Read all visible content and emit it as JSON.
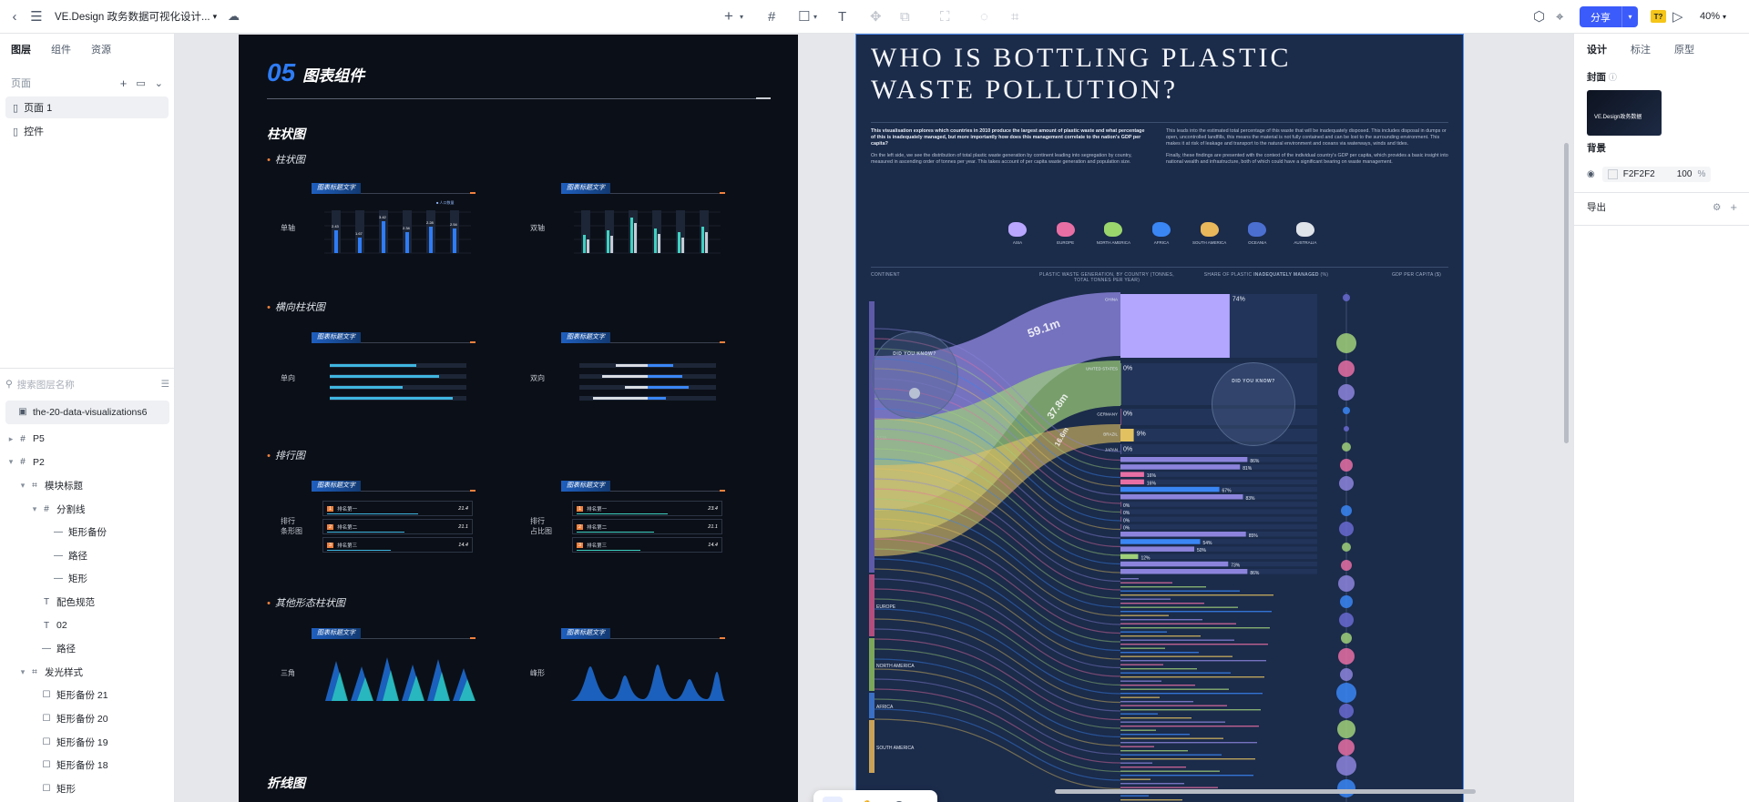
{
  "topbar": {
    "back_icon": "back-icon",
    "menu_icon": "menu-icon",
    "file_title": "VE.Design 政务数据可视化设计...",
    "share_label": "分享",
    "ai_badge": "T?",
    "zoom": "40%"
  },
  "left_panel": {
    "tabs": [
      "图层",
      "组件",
      "资源"
    ],
    "pages_label": "页面",
    "pages": [
      "页面 1",
      "控件"
    ],
    "search_placeholder": "搜索图层名称",
    "layers": [
      {
        "name": "the-20-data-visualizations6",
        "type": "image",
        "depth": 0,
        "caret": ""
      },
      {
        "name": "P5",
        "type": "frame",
        "depth": 0,
        "caret": "▸"
      },
      {
        "name": "P2",
        "type": "frame",
        "depth": 0,
        "caret": "▾"
      },
      {
        "name": "模块标题",
        "type": "group",
        "depth": 1,
        "caret": "▾"
      },
      {
        "name": "分割线",
        "type": "frame",
        "depth": 2,
        "caret": "▾"
      },
      {
        "name": "矩形备份",
        "type": "line",
        "depth": 3,
        "caret": ""
      },
      {
        "name": "路径",
        "type": "line",
        "depth": 3,
        "caret": ""
      },
      {
        "name": "矩形",
        "type": "line",
        "depth": 3,
        "caret": ""
      },
      {
        "name": "配色规范",
        "type": "text",
        "depth": 2,
        "caret": ""
      },
      {
        "name": "02",
        "type": "text",
        "depth": 2,
        "caret": ""
      },
      {
        "name": "路径",
        "type": "line",
        "depth": 2,
        "caret": ""
      },
      {
        "name": "发光样式",
        "type": "group",
        "depth": 1,
        "caret": "▾"
      },
      {
        "name": "矩形备份 21",
        "type": "rect",
        "depth": 2,
        "caret": ""
      },
      {
        "name": "矩形备份 20",
        "type": "rect",
        "depth": 2,
        "caret": ""
      },
      {
        "name": "矩形备份 19",
        "type": "rect",
        "depth": 2,
        "caret": ""
      },
      {
        "name": "矩形备份 18",
        "type": "rect",
        "depth": 2,
        "caret": ""
      },
      {
        "name": "矩形",
        "type": "rect",
        "depth": 2,
        "caret": ""
      }
    ]
  },
  "right_panel": {
    "tabs": [
      "设计",
      "标注",
      "原型"
    ],
    "cover_label": "封面",
    "cover_thumb_text": "VE.Design政务数据",
    "bg_label": "背景",
    "bg_hex": "F2F2F2",
    "bg_opacity": "100",
    "opacity_unit": "%",
    "export_label": "导出"
  },
  "artboard_dark": {
    "num": "05",
    "title": "图表组件",
    "sections": [
      {
        "title": "柱状图",
        "sub": "柱状图"
      },
      {
        "title": "",
        "sub": "横向柱状图"
      },
      {
        "title": "",
        "sub": "排行图"
      },
      {
        "title": "",
        "sub": "其他形态柱状图"
      },
      {
        "title": "折线图",
        "sub": ""
      }
    ],
    "rows": [
      {
        "left_label": "单轴",
        "right_label": "双轴"
      },
      {
        "left_label": "单向",
        "right_label": "双向"
      },
      {
        "left_label": "排行\n条形图",
        "right_label": "排行\n占比图"
      },
      {
        "left_label": "三角",
        "right_label": "峰形"
      }
    ],
    "card_title": "图表标题文字",
    "rank_items_left": [
      {
        "name": "排名第一",
        "value": "21.4"
      },
      {
        "name": "排名第二",
        "value": "21.1"
      },
      {
        "name": "排名第三",
        "value": "14.4"
      }
    ],
    "rank_items_right": [
      {
        "name": "排名第一",
        "value": "23.4"
      },
      {
        "name": "排名第二",
        "value": "21.1"
      },
      {
        "name": "排名第三",
        "value": "14.4"
      }
    ]
  },
  "infographic": {
    "title_line1": "WHO IS BOTTLING PLASTIC",
    "title_line2": "WASTE POLLUTION?",
    "intro_left": "This visualisation explores which countries in 2010 produce the largest amount of plastic waste and what percentage of this is inadequately managed, but more importantly how does this management correlate to the nation's GDP per capita?",
    "intro_left2": "On the left side, we see the distribution of total plastic waste generation by continent leading into segregation by country, measured in ascending order of tonnes per year. This takes account of per capita waste generation and population size.",
    "intro_right": "This leads into the estimated total percentage of this waste that will be inadequately disposed. This includes disposal in dumps or open, uncontrolled landfills, this means the material is not fully contained and can be lost to the surrounding environment. This makes it at risk of leakage and transport to the natural environment and oceans via waterways, winds and tides.",
    "intro_right2": "Finally, these findings are presented with the context of the individual country's GDP per capita, which provides a basic insight into national wealth and infrastructure, both of which could have a significant bearing on waste management.",
    "continents": [
      "ASIA",
      "EUROPE",
      "NORTH AMERICA",
      "AFRICA",
      "SOUTH AMERICA",
      "OCEANIA",
      "AUSTRALIA"
    ],
    "col_continent": "CONTINENT",
    "col_generation": "PLASTIC WASTE GENERATION, BY COUNTRY (TONNES, TOTAL TONNES PER YEAR)",
    "col_share_pre": "SHARE OF PLASTIC",
    "col_share_bold": "INADEQUATELY MANAGED",
    "col_share_post": "(%)",
    "col_gdp": "GDP PER CAPITA ($)",
    "pct_ticks": [
      "0%",
      "20%",
      "40%",
      "60%",
      "80%",
      "100%"
    ],
    "flow_labels": [
      "59.1m",
      "37.8m",
      "16.6m"
    ],
    "did_you_know": "DID YOU KNOW?",
    "side_labels": [
      "ASIA",
      "EUROPE",
      "NORTH AMERICA",
      "AFRICA",
      "SOUTH AMERICA"
    ],
    "countries": [
      {
        "name": "CHINA",
        "pct": "74%"
      },
      {
        "name": "UNITED STATES",
        "pct": "0%"
      },
      {
        "name": "GERMANY",
        "pct": "0%"
      },
      {
        "name": "BRAZIL",
        "pct": "9%"
      },
      {
        "name": "JAPAN",
        "pct": "0%"
      },
      {
        "name": "",
        "pct": "86%"
      },
      {
        "name": "",
        "pct": "81%"
      },
      {
        "name": "",
        "pct": "16%"
      },
      {
        "name": "",
        "pct": "16%"
      },
      {
        "name": "",
        "pct": "67%"
      },
      {
        "name": "",
        "pct": "83%"
      },
      {
        "name": "",
        "pct": "0%"
      },
      {
        "name": "",
        "pct": "0%"
      },
      {
        "name": "",
        "pct": "0%"
      },
      {
        "name": "",
        "pct": "0%"
      },
      {
        "name": "",
        "pct": "85%"
      },
      {
        "name": "",
        "pct": "54%"
      },
      {
        "name": "",
        "pct": "50%"
      },
      {
        "name": "",
        "pct": "12%"
      },
      {
        "name": "",
        "pct": "73%"
      },
      {
        "name": "",
        "pct": "86%"
      }
    ]
  },
  "tools": [
    "cursor-icon",
    "hand-icon",
    "comment-icon",
    "more-icon"
  ],
  "help_label": "?"
}
